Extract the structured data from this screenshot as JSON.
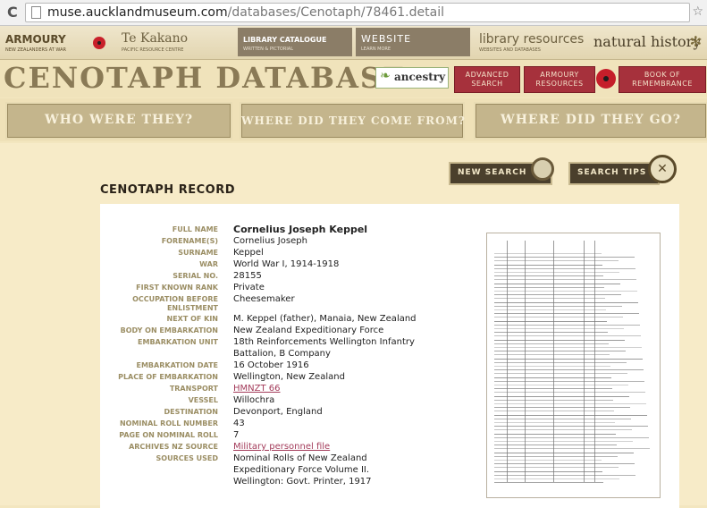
{
  "browser": {
    "url_host": "muse.aucklandmuseum.com",
    "url_path": "/databases/Cenotaph/78461.detail"
  },
  "topnav": {
    "armoury_title": "ARMOURY",
    "armoury_sub": "NEW ZEALANDERS AT WAR",
    "tekakano_title": "Te Kakano",
    "tekakano_sub": "PACIFIC RESOURCE CENTRE",
    "library_catalogue_title": "LIBRARY CATALOGUE",
    "library_catalogue_sub": "WRITTEN & PICTORIAL",
    "website_title": "WEBSITE",
    "website_sub": "LEARN MORE",
    "library_resources_title": "library resources",
    "library_resources_sub": "WEBSITES AND DATABASES",
    "natural_history_title": "natural history"
  },
  "header": {
    "site_title": "CENOTAPH DATABASE",
    "ancestry_label": "ancestry",
    "advanced_search_line1": "ADVANCED",
    "advanced_search_line2": "SEARCH",
    "armoury_resources_line1": "ARMOURY",
    "armoury_resources_line2": "RESOURCES",
    "book_line1": "BOOK OF",
    "book_line2": "REMEMBRANCE"
  },
  "sections": {
    "who": "WHO WERE THEY?",
    "where_from": "WHERE DID THEY COME FROM?",
    "where_go": "WHERE DID THEY GO?"
  },
  "actions": {
    "new_search": "NEW SEARCH",
    "search_tips": "SEARCH TIPS"
  },
  "record": {
    "heading": "CENOTAPH RECORD",
    "fields": [
      {
        "label": "FULL NAME",
        "value": "Cornelius Joseph Keppel"
      },
      {
        "label": "FORENAME(S)",
        "value": "Cornelius Joseph"
      },
      {
        "label": "SURNAME",
        "value": "Keppel"
      },
      {
        "label": "WAR",
        "value": "World War I, 1914-1918"
      },
      {
        "label": "SERIAL NO.",
        "value": "28155"
      },
      {
        "label": "FIRST KNOWN RANK",
        "value": "Private"
      },
      {
        "label": "OCCUPATION BEFORE ENLISTMENT",
        "value": "Cheesemaker"
      },
      {
        "label": "NEXT OF KIN",
        "value": "M. Keppel (father), Manaia, New Zealand"
      },
      {
        "label": "BODY ON EMBARKATION",
        "value": "New Zealand Expeditionary Force"
      },
      {
        "label": "EMBARKATION UNIT",
        "value": "18th Reinforcements Wellington Infantry Battalion, B Company"
      },
      {
        "label": "EMBARKATION DATE",
        "value": "16 October 1916"
      },
      {
        "label": "PLACE OF EMBARKATION",
        "value": "Wellington, New Zealand"
      },
      {
        "label": "TRANSPORT",
        "value": "HMNZT 66"
      },
      {
        "label": "VESSEL",
        "value": "Willochra"
      },
      {
        "label": "DESTINATION",
        "value": "Devonport, England"
      },
      {
        "label": "NOMINAL ROLL NUMBER",
        "value": "43"
      },
      {
        "label": "PAGE ON NOMINAL ROLL",
        "value": "7"
      },
      {
        "label": "ARCHIVES NZ SOURCE",
        "value": "Military personnel file"
      },
      {
        "label": "SOURCES USED",
        "value": "Nominal Rolls of New Zealand Expeditionary Force Volume II. Wellington: Govt. Printer, 1917"
      }
    ]
  }
}
